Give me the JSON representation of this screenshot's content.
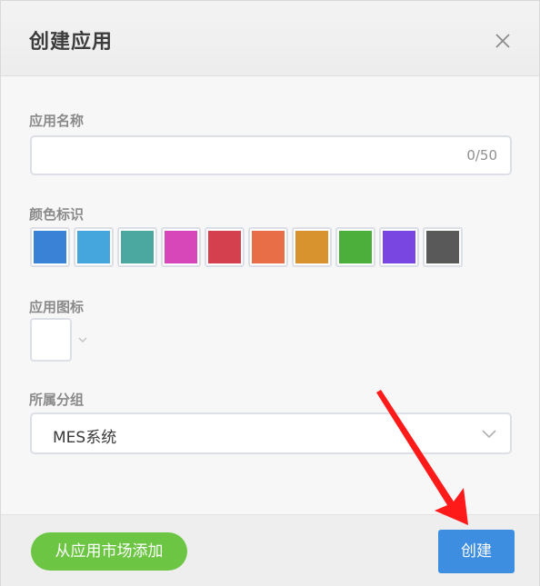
{
  "dialog": {
    "title": "创建应用",
    "close_icon": "close-icon"
  },
  "form": {
    "app_name": {
      "label": "应用名称",
      "value": "",
      "counter": "0/50"
    },
    "color": {
      "label": "颜色标识",
      "swatches": [
        {
          "color": "#3a82d6"
        },
        {
          "color": "#44a6dc"
        },
        {
          "color": "#4aa8a0"
        },
        {
          "color": "#d847b9"
        },
        {
          "color": "#d4404e"
        },
        {
          "color": "#e76e47"
        },
        {
          "color": "#d8932f"
        },
        {
          "color": "#4caf3b"
        },
        {
          "color": "#7a46e2"
        },
        {
          "color": "#595959"
        }
      ]
    },
    "app_icon": {
      "label": "应用图标",
      "dropdown_icon": "chevron-down-icon"
    },
    "group": {
      "label": "所属分组",
      "selected": "MES系统",
      "dropdown_icon": "chevron-down-icon"
    }
  },
  "footer": {
    "market_button": "从应用市场添加",
    "create_button": "创建"
  },
  "colors": {
    "accent": "#3d8ee0",
    "market_green": "#6cc644",
    "annotation_arrow": "#ff1a1a"
  }
}
